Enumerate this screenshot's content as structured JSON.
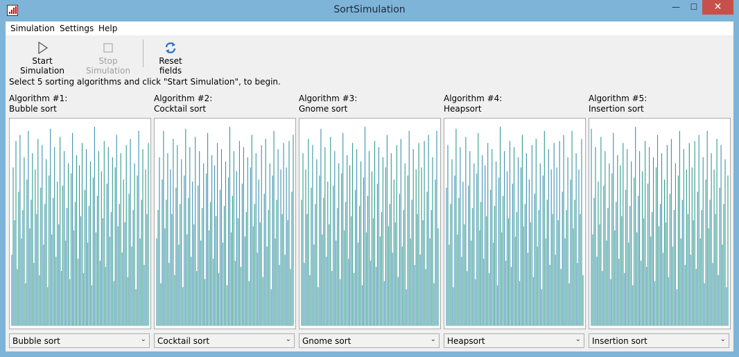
{
  "window": {
    "title": "SortSimulation",
    "min_glyph": "—",
    "max_glyph": "☐",
    "close_glyph": "✕"
  },
  "menu": [
    "Simulation",
    "Settings",
    "Help"
  ],
  "toolbar": {
    "start_label": "Start Simulation",
    "stop_label": "Stop Simulation",
    "reset_label": "Reset fields"
  },
  "instructions": "Select 5 sorting algorithms and click \"Start Simulation\", to begin.",
  "algorithms": [
    {
      "header": "Algorithm #1:",
      "name": "Bubble sort",
      "selected": "Bubble sort"
    },
    {
      "header": "Algorithm #2:",
      "name": "Cocktail sort",
      "selected": "Cocktail sort"
    },
    {
      "header": "Algorithm #3:",
      "name": "Gnome sort",
      "selected": "Gnome sort"
    },
    {
      "header": "Algorithm #4:",
      "name": "Heapsort",
      "selected": "Heapsort"
    },
    {
      "header": "Algorithm #5:",
      "name": "Insertion sort",
      "selected": "Insertion sort"
    }
  ],
  "colors": {
    "bar": "#3d8fb0",
    "bar_alt": "#2f9a8a",
    "close": "#c7504a"
  },
  "icons": {
    "start": "play-icon",
    "stop": "stop-icon",
    "reset": "refresh-icon",
    "dropdown": "chevron-down-icon"
  },
  "bar_values": [
    0.35,
    0.78,
    0.52,
    0.91,
    0.28,
    0.66,
    0.94,
    0.43,
    0.57,
    0.83,
    0.21,
    0.72,
    0.96,
    0.48,
    0.62,
    0.85,
    0.31,
    0.77,
    0.55,
    0.92,
    0.25,
    0.68,
    0.89,
    0.4,
    0.6,
    0.82,
    0.19,
    0.74,
    0.97,
    0.45,
    0.63,
    0.88,
    0.34,
    0.71,
    0.5,
    0.93,
    0.27,
    0.69,
    0.86,
    0.42,
    0.58,
    0.8,
    0.23,
    0.75,
    0.95,
    0.47,
    0.61,
    0.84,
    0.33,
    0.79,
    0.54,
    0.9,
    0.26,
    0.67,
    0.87,
    0.41,
    0.59,
    0.81,
    0.2,
    0.73,
    0.98,
    0.46,
    0.64,
    0.86,
    0.32,
    0.76,
    0.53,
    0.91,
    0.29,
    0.7,
    0.88,
    0.44,
    0.56,
    0.83,
    0.22,
    0.78,
    0.94,
    0.49,
    0.6,
    0.85,
    0.36,
    0.72,
    0.51,
    0.89,
    0.24,
    0.65,
    0.92,
    0.39,
    0.57,
    0.8,
    0.18,
    0.74,
    0.96,
    0.43,
    0.62,
    0.87,
    0.3,
    0.77,
    0.55,
    0.9
  ]
}
